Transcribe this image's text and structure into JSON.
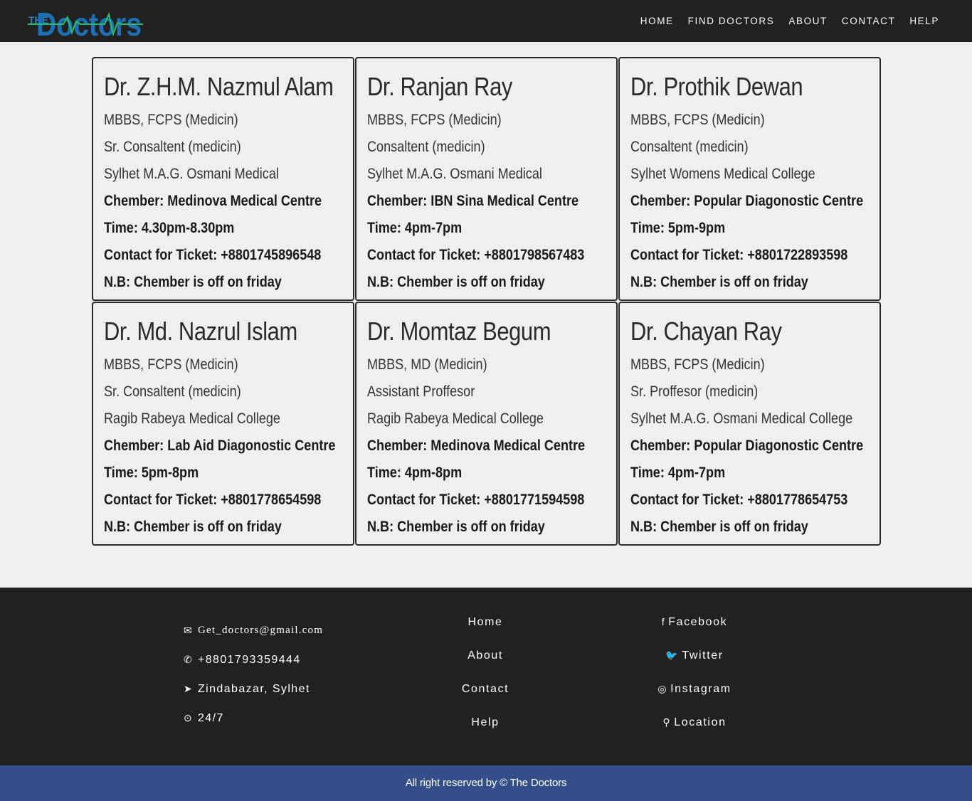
{
  "logo": {
    "prefix": "THE",
    "name": "Doctors"
  },
  "nav": [
    "HOME",
    "FIND DOCTORS",
    "ABOUT",
    "CONTACT",
    "HELP"
  ],
  "doctors": [
    {
      "name": "Dr. Z.H.M. Nazmul Alam",
      "degree": "MBBS, FCPS (Medicin)",
      "position": "Sr. Consaltent (medicin)",
      "institution": "Sylhet M.A.G. Osmani Medical",
      "chember": "Chember: Medinova Medical Centre",
      "time": "Time: 4.30pm-8.30pm",
      "contact": "Contact for Ticket: +8801745896548",
      "note": "N.B: Chember is off on friday"
    },
    {
      "name": "Dr. Ranjan Ray",
      "degree": "MBBS, FCPS (Medicin)",
      "position": "Consaltent (medicin)",
      "institution": "Sylhet M.A.G. Osmani Medical",
      "chember": "Chember: IBN Sina Medical Centre",
      "time": "Time: 4pm-7pm",
      "contact": "Contact for Ticket: +8801798567483",
      "note": "N.B: Chember is off on friday"
    },
    {
      "name": "Dr. Prothik Dewan",
      "degree": "MBBS, FCPS (Medicin)",
      "position": "Consaltent (medicin)",
      "institution": "Sylhet Womens Medical College",
      "chember": "Chember: Popular Diagonostic Centre",
      "time": "Time: 5pm-9pm",
      "contact": "Contact for Ticket: +8801722893598",
      "note": "N.B: Chember is off on friday"
    },
    {
      "name": "Dr. Md. Nazrul Islam",
      "degree": "MBBS, FCPS (Medicin)",
      "position": "Sr. Consaltent (medicin)",
      "institution": "Ragib Rabeya Medical College",
      "chember": "Chember: Lab Aid Diagonostic Centre",
      "time": "Time: 5pm-8pm",
      "contact": "Contact for Ticket: +8801778654598",
      "note": "N.B: Chember is off on friday"
    },
    {
      "name": "Dr. Momtaz Begum",
      "degree": "MBBS, MD (Medicin)",
      "position": "Assistant Proffesor",
      "institution": "Ragib Rabeya Medical College",
      "chember": "Chember: Medinova Medical Centre",
      "time": "Time: 4pm-8pm",
      "contact": "Contact for Ticket: +8801771594598",
      "note": "N.B: Chember is off on friday"
    },
    {
      "name": "Dr. Chayan Ray",
      "degree": "MBBS, FCPS (Medicin)",
      "position": "Sr. Proffesor (medicin)",
      "institution": "Sylhet M.A.G. Osmani Medical College",
      "chember": "Chember: Popular Diagonostic Centre",
      "time": "Time: 4pm-7pm",
      "contact": "Contact for Ticket: +8801778654753",
      "note": "N.B: Chember is off on friday"
    }
  ],
  "footer": {
    "contact": {
      "email": "Get_doctors@gmail.com",
      "phone": "+8801793359444",
      "address": "Zindabazar, Sylhet",
      "hours": "24/7"
    },
    "links": [
      "Home",
      "About",
      "Contact",
      "Help"
    ],
    "social": [
      "Facebook",
      "Twitter",
      "Instagram",
      "Location"
    ],
    "icons": [
      "envelope-icon",
      "phone-icon",
      "location-arrow-icon",
      "clock-icon",
      "facebook-icon",
      "twitter-icon",
      "instagram-icon",
      "map-marker-icon"
    ]
  },
  "copyright": "All right reserved by © The Doctors",
  "colors": {
    "navbar": "#212121",
    "page": "#efefef",
    "footer": "#212121",
    "copyright_bar": "#334e88",
    "logo_blue": "#1f6fb5",
    "logo_pulse": "#2bbf6b"
  }
}
